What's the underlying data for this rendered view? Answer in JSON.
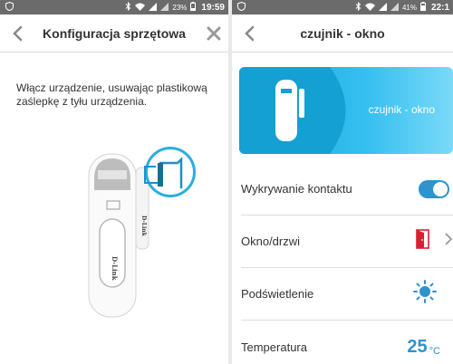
{
  "left": {
    "statusbar": {
      "battery": "23%",
      "time": "19:59"
    },
    "title": "Konfiguracja sprzętowa",
    "instruction": "Włącz urządzenie, usuwając plastikową zaślepkę z tyłu urządzenia.",
    "device_logo": "D-Link"
  },
  "right": {
    "statusbar": {
      "battery": "41%",
      "time": "22:1"
    },
    "title": "czujnik - okno",
    "hero_label": "czujnik - okno",
    "rows": [
      {
        "label": "Wykrywanie kontaktu"
      },
      {
        "label": "Okno/drzwi"
      },
      {
        "label": "Podświetlenie"
      },
      {
        "label": "Temperatura"
      }
    ],
    "temperature": {
      "value": "25",
      "unit": "°C"
    },
    "contact_detection_enabled": true
  },
  "colors": {
    "accent": "#2e93cf",
    "door": "#d9202f",
    "hero": "#29b6e8",
    "statusbar": "#6b6b6b"
  }
}
